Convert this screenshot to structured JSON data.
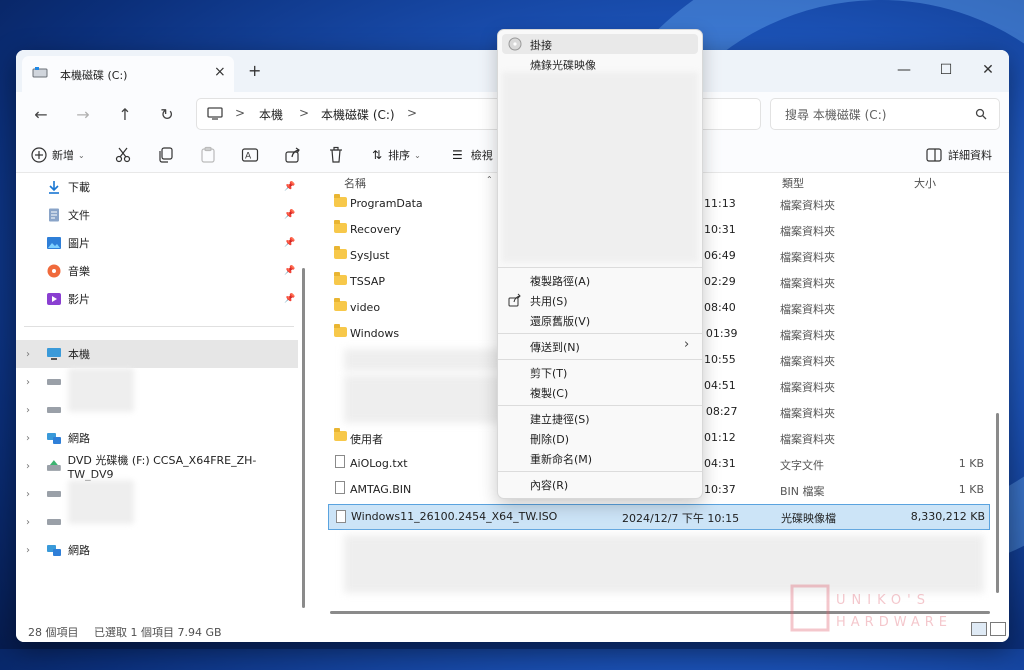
{
  "window": {
    "tab_title": "本機磁碟 (C:)",
    "new_tab": "+",
    "close_tab": "×",
    "min": "—",
    "max": "☐",
    "close": "✕"
  },
  "nav": {
    "back": "←",
    "forward": "→",
    "up": "↑",
    "refresh": "↻"
  },
  "address": {
    "segments": [
      "本機",
      "本機磁碟 (C:)"
    ],
    "sep": ">"
  },
  "search": {
    "placeholder": "搜尋 本機磁碟 (C:)"
  },
  "toolbar": {
    "new_label": "新增",
    "sort_label": "排序",
    "view_label": "檢視",
    "details_label": "詳細資料"
  },
  "sidebar": {
    "items": [
      {
        "label": "下載",
        "icon": "download-icon"
      },
      {
        "label": "文件",
        "icon": "document-icon"
      },
      {
        "label": "圖片",
        "icon": "pictures-icon"
      },
      {
        "label": "音樂",
        "icon": "music-icon"
      },
      {
        "label": "影片",
        "icon": "video-icon"
      },
      {
        "label": "本機",
        "icon": "pc-icon"
      },
      {
        "label": "網路",
        "icon": "network-icon"
      },
      {
        "label": "DVD 光碟機 (F:) CCSA_X64FRE_ZH-TW_DV9",
        "icon": "dvd-drive-icon"
      },
      {
        "label": "網路",
        "icon": "network-icon"
      }
    ]
  },
  "columns": {
    "name": "名稱",
    "type": "類型",
    "size": "大小"
  },
  "files": [
    {
      "name": "ProgramData",
      "date": "11:13",
      "type": "檔案資料夾",
      "size": ""
    },
    {
      "name": "Recovery",
      "date": "10:31",
      "type": "檔案資料夾",
      "size": ""
    },
    {
      "name": "SysJust",
      "date": "06:49",
      "type": "檔案資料夾",
      "size": ""
    },
    {
      "name": "TSSAP",
      "date": "02:29",
      "type": "檔案資料夾",
      "size": ""
    },
    {
      "name": "video",
      "date": "08:40",
      "type": "檔案資料夾",
      "size": ""
    },
    {
      "name": "Windows",
      "date": "F 01:39",
      "type": "檔案資料夾",
      "size": ""
    },
    {
      "name": "",
      "date": "10:55",
      "type": "檔案資料夾",
      "size": ""
    },
    {
      "name": "",
      "date": "04:51",
      "type": "檔案資料夾",
      "size": ""
    },
    {
      "name": "",
      "date": "F 08:27",
      "type": "檔案資料夾",
      "size": ""
    },
    {
      "name": "使用者",
      "date": "01:12",
      "type": "檔案資料夾",
      "size": ""
    },
    {
      "name": "AiOLog.txt",
      "date": "04:31",
      "type": "文字文件",
      "size": "1 KB"
    },
    {
      "name": "AMTAG.BIN",
      "date": "10:37",
      "type": "BIN 檔案",
      "size": "1 KB"
    },
    {
      "name": "Windows11_26100.2454_X64_TW.ISO",
      "date": "2024/12/7 下午 10:15",
      "type": "光碟映像檔",
      "size": "8,330,212 KB"
    }
  ],
  "context_menu": {
    "mount": "掛接",
    "burn": "燒錄光碟映像",
    "copy_path": "複製路徑(A)",
    "share": "共用(S)",
    "restore": "還原舊版(V)",
    "send_to": "傳送到(N)",
    "cut": "剪下(T)",
    "copy": "複製(C)",
    "shortcut": "建立捷徑(S)",
    "delete": "刪除(D)",
    "rename": "重新命名(M)",
    "properties": "內容(R)",
    "submenu_arrow": "›"
  },
  "status": {
    "count": "28 個項目",
    "selected": "已選取 1 個項目 7.94 GB"
  },
  "watermark": {
    "text": "UNIKO'S HARDWARE"
  },
  "colors": {
    "accent": "#0067c0",
    "selection": "#cce4f7",
    "folder": "#f7c84a"
  }
}
